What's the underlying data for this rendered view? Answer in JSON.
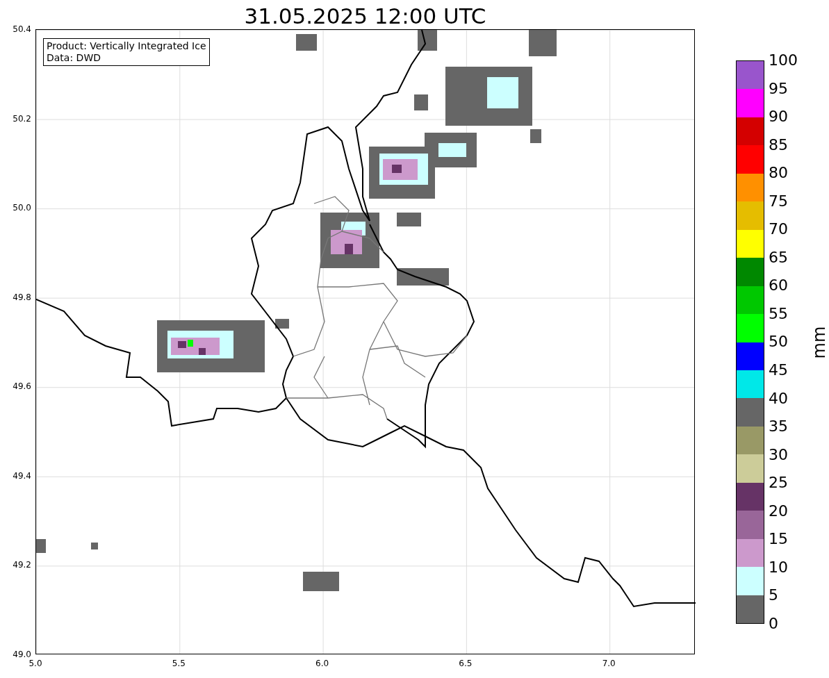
{
  "title": "31.05.2025 12:00 UTC",
  "info_box": {
    "lines": [
      "Product: Vertically Integrated Ice",
      "Data: DWD"
    ]
  },
  "map": {
    "xticks": [
      "5.0",
      "5.5",
      "6.0",
      "6.5",
      "7.0"
    ],
    "yticks": [
      "50.4",
      "50.2",
      "50.0",
      "49.8",
      "49.6",
      "49.4",
      "49.2",
      "49.0"
    ]
  },
  "colorbar": {
    "unit": "mm",
    "ticks": [
      "100",
      "95",
      "90",
      "85",
      "80",
      "75",
      "70",
      "65",
      "60",
      "55",
      "50",
      "45",
      "40",
      "35",
      "30",
      "25",
      "20",
      "15",
      "10",
      "5",
      "0"
    ],
    "bins": [
      {
        "color": "#9955cc"
      },
      {
        "color": "#ff00ff"
      },
      {
        "color": "#d40000"
      },
      {
        "color": "#ff0000"
      },
      {
        "color": "#ff9000"
      },
      {
        "color": "#e5bd00"
      },
      {
        "color": "#ffff00"
      },
      {
        "color": "#008800"
      },
      {
        "color": "#00c800"
      },
      {
        "color": "#00ff00"
      },
      {
        "color": "#0000ff"
      },
      {
        "color": "#00e8e8"
      },
      {
        "color": "#666666"
      },
      {
        "color": "#999966"
      },
      {
        "color": "#cccc99"
      },
      {
        "color": "#663366"
      },
      {
        "color": "#996699"
      },
      {
        "color": "#cc99cc"
      },
      {
        "color": "#ccffff"
      },
      {
        "color": "#666666"
      }
    ]
  }
}
